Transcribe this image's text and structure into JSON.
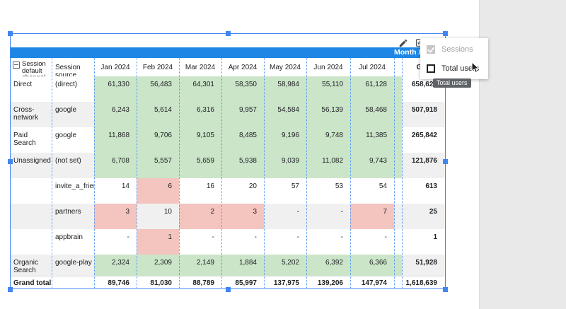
{
  "palette": {
    "header_bar_blue": "#1e87e5",
    "conditional_green": "#cbe5c9",
    "conditional_pink": "#f4c4bf",
    "row_stripe_gray": "#f0f0f0",
    "selection_blue": "#4285f4",
    "canvas_gray": "#e9e9e9",
    "tooltip_bg": "#5f6368"
  },
  "toolbar": {
    "edit_icon": "edit-pencil",
    "options_icon": "chart-options"
  },
  "pivot_header_bar": {
    "title": "Month / S"
  },
  "metric_menu": {
    "items": [
      {
        "label": "Sessions",
        "checked": true,
        "disabled": true
      },
      {
        "label": "Total users",
        "checked": false,
        "disabled": false
      }
    ]
  },
  "tooltip": {
    "text": "Total users"
  },
  "table": {
    "corner_header": "Session default channel",
    "source_header": "Session source",
    "month_headers": [
      "Jan 2024",
      "Feb 2024",
      "Mar 2024",
      "Apr 2024",
      "May 2024",
      "Jun 2024",
      "Jul 2024"
    ],
    "grand_total_header": "Grand total",
    "rows": [
      {
        "channel": "Direct",
        "source": "(direct)",
        "values": [
          "61,330",
          "56,483",
          "64,301",
          "58,350",
          "58,984",
          "55,110",
          "61,128"
        ],
        "total": "658,621",
        "bg": [
          "g",
          "g",
          "g",
          "g",
          "g",
          "g",
          "g"
        ],
        "strip": "g",
        "stripe": "w"
      },
      {
        "channel": "Cross-network",
        "source": "google",
        "values": [
          "6,243",
          "5,614",
          "6,316",
          "9,957",
          "54,584",
          "56,139",
          "58,468"
        ],
        "total": "507,918",
        "bg": [
          "g",
          "g",
          "g",
          "g",
          "g",
          "g",
          "g"
        ],
        "strip": "g",
        "stripe": "s"
      },
      {
        "channel": "Paid Search",
        "source": "google",
        "values": [
          "11,868",
          "9,706",
          "9,105",
          "8,485",
          "9,196",
          "9,748",
          "11,385"
        ],
        "total": "265,842",
        "bg": [
          "g",
          "g",
          "g",
          "g",
          "g",
          "g",
          "g"
        ],
        "strip": "g",
        "stripe": "w"
      },
      {
        "channel": "Unassigned",
        "source": "(not set)",
        "values": [
          "6,708",
          "5,557",
          "5,659",
          "5,938",
          "9,039",
          "11,082",
          "9,743"
        ],
        "total": "121,876",
        "bg": [
          "g",
          "g",
          "g",
          "g",
          "g",
          "g",
          "g"
        ],
        "strip": "g",
        "stripe": "s"
      },
      {
        "channel": "",
        "source": "invite_a_friend",
        "values": [
          "14",
          "6",
          "16",
          "20",
          "57",
          "53",
          "54"
        ],
        "total": "613",
        "bg": [
          "w",
          "p",
          "w",
          "w",
          "w",
          "w",
          "w"
        ],
        "strip": "w",
        "stripe": "w"
      },
      {
        "channel": "",
        "source": "partners",
        "values": [
          "3",
          "10",
          "2",
          "3",
          "-",
          "-",
          "7"
        ],
        "total": "25",
        "bg": [
          "p",
          "s",
          "p",
          "p",
          "s",
          "s",
          "p"
        ],
        "strip": "s",
        "stripe": "s"
      },
      {
        "channel": "",
        "source": "appbrain",
        "values": [
          "-",
          "1",
          "-",
          "-",
          "-",
          "-",
          "-"
        ],
        "total": "1",
        "bg": [
          "w",
          "p",
          "w",
          "w",
          "w",
          "w",
          "w"
        ],
        "strip": "w",
        "stripe": "w"
      },
      {
        "channel": "Organic Search",
        "source": "google-play",
        "values": [
          "2,324",
          "2,309",
          "2,149",
          "1,884",
          "5,202",
          "6,392",
          "6,366"
        ],
        "total": "51,928",
        "bg": [
          "g",
          "g",
          "g",
          "g",
          "g",
          "g",
          "g"
        ],
        "strip": "g",
        "stripe": "s"
      }
    ],
    "grand_total_row": {
      "label": "Grand total",
      "values": [
        "89,746",
        "81,030",
        "88,789",
        "85,997",
        "137,975",
        "139,206",
        "147,974"
      ],
      "total": "1,618,639"
    }
  }
}
